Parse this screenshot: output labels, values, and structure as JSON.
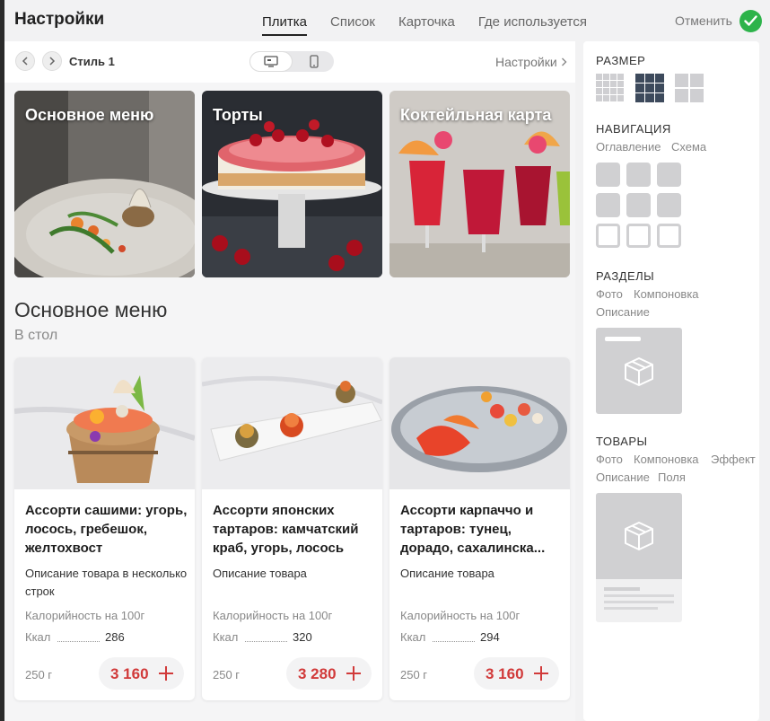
{
  "header": {
    "title": "Настройки",
    "tabs": [
      {
        "label": "Плитка",
        "active": true
      },
      {
        "label": "Список",
        "active": false
      },
      {
        "label": "Карточка",
        "active": false
      },
      {
        "label": "Где используется",
        "active": false
      }
    ],
    "cancel_label": "Отменить",
    "confirm_icon": "check-circle-icon"
  },
  "toolbar": {
    "style_label": "Стиль 1",
    "device_selected": "desktop",
    "settings_label": "Настройки"
  },
  "categories": [
    {
      "label": "Основное меню"
    },
    {
      "label": "Торты"
    },
    {
      "label": "Коктейльная карта"
    }
  ],
  "section": {
    "title": "Основное меню",
    "subtitle": "В стол"
  },
  "products": [
    {
      "name": "Ассорти сашими: угорь, лосось, гребешок, желтохвост",
      "description": "Описание товара в несколько строк",
      "calorie_label": "Калорийность на 100г",
      "kcal_label": "Ккал",
      "kcal": "286",
      "weight": "250 г",
      "price": "3 160"
    },
    {
      "name": "Ассорти японских тартаров: камчатский краб, угорь, лосось",
      "description": "Описание товара",
      "calorie_label": "Калорийность на 100г",
      "kcal_label": "Ккал",
      "kcal": "320",
      "weight": "250 г",
      "price": "3 280"
    },
    {
      "name": "Ассорти карпаччо и тартаров: тунец, дорадо, сахалинска...",
      "description": "Описание товара",
      "calorie_label": "Калорийность на 100г",
      "kcal_label": "Ккал",
      "kcal": "294",
      "weight": "250 г",
      "price": "3 160"
    }
  ],
  "sidebar": {
    "size": {
      "heading": "РАЗМЕР",
      "options": [
        "small",
        "medium",
        "large"
      ],
      "selected": "medium"
    },
    "navigation": {
      "heading": "НАВИГАЦИЯ",
      "links": [
        "Оглавление",
        "Схема"
      ]
    },
    "sections": {
      "heading": "РАЗДЕЛЫ",
      "links": [
        "Фото",
        "Компоновка",
        "Описание"
      ]
    },
    "goods": {
      "heading": "ТОВАРЫ",
      "links": [
        "Фото",
        "Компоновка",
        "Эффект",
        "Описание",
        "Поля"
      ]
    }
  },
  "colors": {
    "accent_green": "#2db34a",
    "price_red": "#d13a3a",
    "size_selected": "#3d4a5c"
  }
}
